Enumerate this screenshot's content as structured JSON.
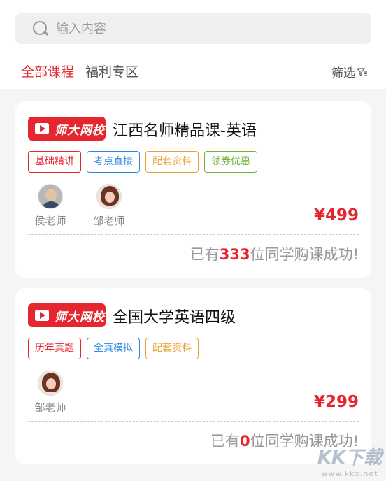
{
  "search": {
    "placeholder": "输入内容"
  },
  "tabs": [
    {
      "label": "全部课程",
      "active": true
    },
    {
      "label": "福利专区",
      "active": false
    }
  ],
  "filter": {
    "label": "筛选"
  },
  "brand": {
    "logo_text": "师大网校",
    "color": "#e6262e"
  },
  "courses": [
    {
      "title": "江西名师精品课-英语",
      "tags": [
        {
          "label": "基础精讲",
          "color": "#e6262e"
        },
        {
          "label": "考点直接",
          "color": "#2b8ae6"
        },
        {
          "label": "配套资料",
          "color": "#e8a33a"
        },
        {
          "label": "领券优惠",
          "color": "#6fb135"
        }
      ],
      "teachers": [
        {
          "name": "侯老师",
          "avatar": "man-glasses"
        },
        {
          "name": "邹老师",
          "avatar": "woman"
        }
      ],
      "price": "¥499",
      "buyers_prefix": "已有",
      "buyers_count": "333",
      "buyers_suffix": "位同学购课成功!"
    },
    {
      "title": "全国大学英语四级",
      "tags": [
        {
          "label": "历年真题",
          "color": "#e6262e"
        },
        {
          "label": "全真模拟",
          "color": "#2b8ae6"
        },
        {
          "label": "配套资料",
          "color": "#e8a33a"
        }
      ],
      "teachers": [
        {
          "name": "邹老师",
          "avatar": "woman"
        }
      ],
      "price": "¥299",
      "buyers_prefix": "已有",
      "buyers_count": "0",
      "buyers_suffix": "位同学购课成功!"
    }
  ],
  "watermark": {
    "main": "KK下载",
    "sub": "www.kkx.net"
  }
}
